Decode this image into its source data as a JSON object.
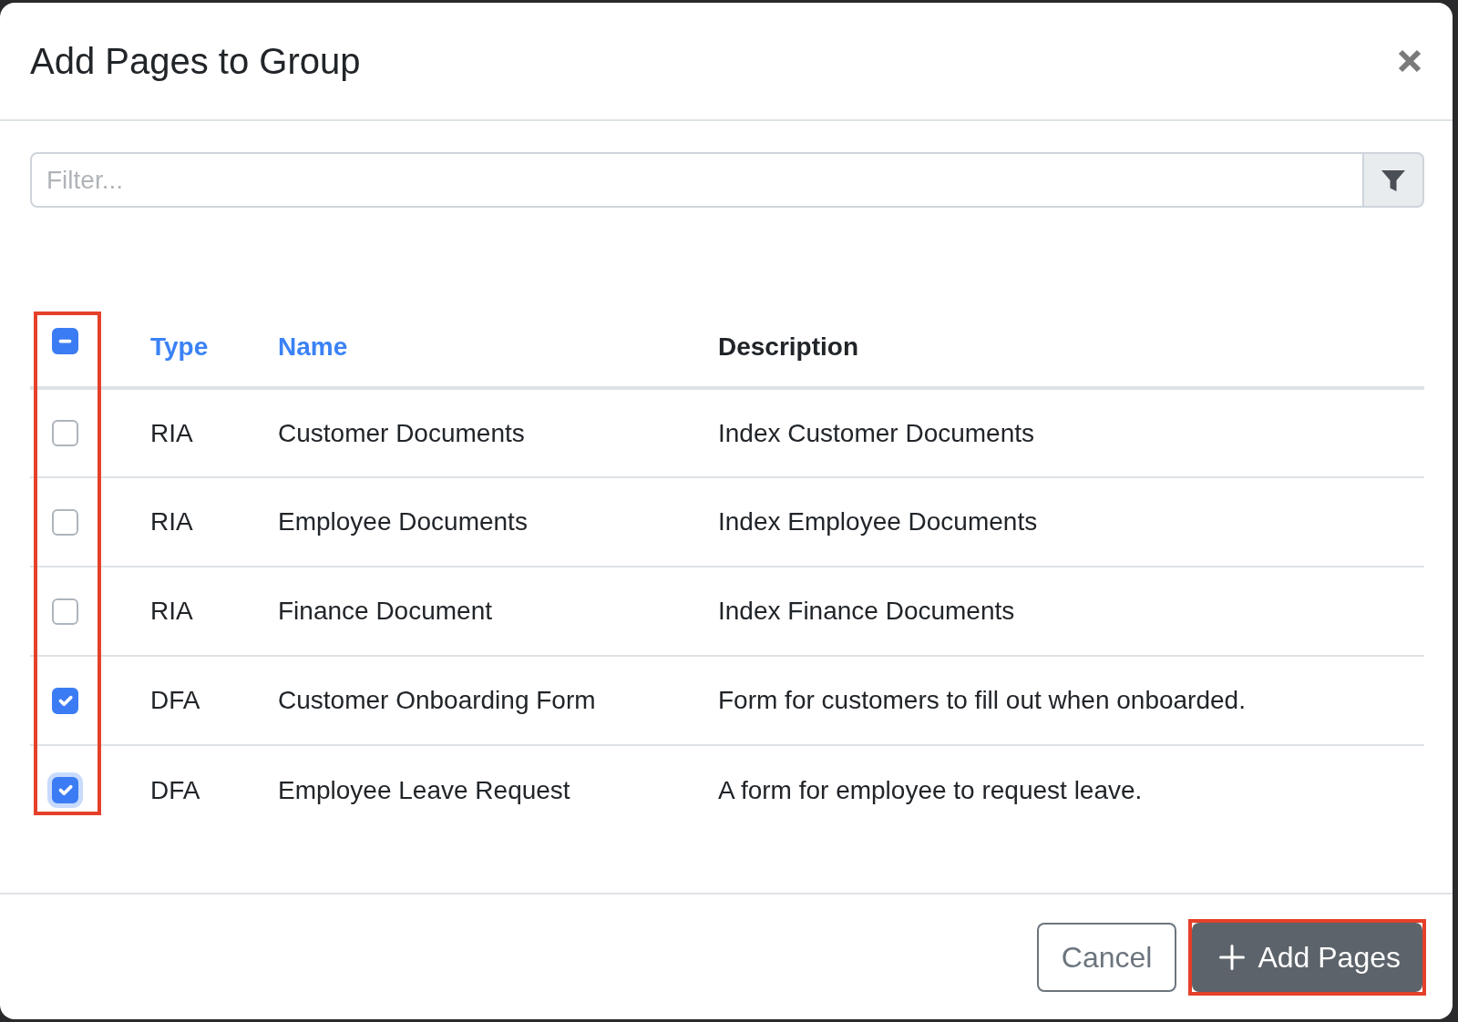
{
  "dialog": {
    "title": "Add Pages to Group"
  },
  "filter": {
    "placeholder": "Filter..."
  },
  "table": {
    "checkbox_column_highlighted": true,
    "select_all": {
      "indeterminate": true
    },
    "columns": [
      {
        "label": "Type",
        "sortable": true
      },
      {
        "label": "Name",
        "sortable": true
      },
      {
        "label": "Description",
        "sortable": false
      }
    ],
    "rows": [
      {
        "checked": false,
        "focused": false,
        "cells": [
          "RIA",
          "Customer Documents",
          "Index Customer Documents"
        ]
      },
      {
        "checked": false,
        "focused": false,
        "cells": [
          "RIA",
          "Employee Documents",
          "Index Employee Documents"
        ]
      },
      {
        "checked": false,
        "focused": false,
        "cells": [
          "RIA",
          "Finance Document",
          "Index Finance Documents"
        ]
      },
      {
        "checked": true,
        "focused": false,
        "cells": [
          "DFA",
          "Customer Onboarding Form",
          "Form for customers to fill out when onboarded."
        ]
      },
      {
        "checked": true,
        "focused": true,
        "cells": [
          "DFA",
          "Employee Leave Request",
          "A form for employee to request leave."
        ]
      }
    ]
  },
  "footer": {
    "buttons": [
      {
        "kind": "outline",
        "label": "Cancel",
        "highlighted": false
      },
      {
        "kind": "add",
        "label": "Add Pages",
        "highlighted": true
      }
    ]
  }
}
